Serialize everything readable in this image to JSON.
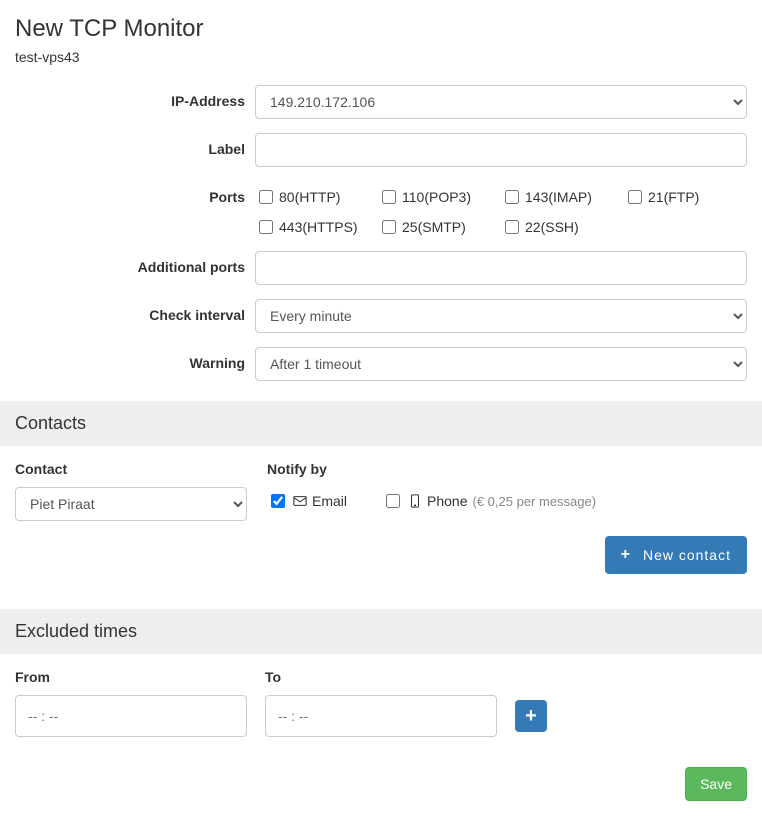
{
  "page": {
    "title": "New TCP Monitor",
    "subtitle": "test-vps43"
  },
  "form": {
    "labels": {
      "ip_address": "IP-Address",
      "label": "Label",
      "ports": "Ports",
      "additional_ports": "Additional ports",
      "check_interval": "Check interval",
      "warning": "Warning"
    },
    "ip_address": {
      "value": "149.210.172.106"
    },
    "label_field": {
      "value": ""
    },
    "ports": [
      {
        "label": "80(HTTP)",
        "checked": false
      },
      {
        "label": "110(POP3)",
        "checked": false
      },
      {
        "label": "143(IMAP)",
        "checked": false
      },
      {
        "label": "21(FTP)",
        "checked": false
      },
      {
        "label": "443(HTTPS)",
        "checked": false
      },
      {
        "label": "25(SMTP)",
        "checked": false
      },
      {
        "label": "22(SSH)",
        "checked": false
      }
    ],
    "additional_ports": {
      "value": ""
    },
    "check_interval": {
      "value": "Every minute"
    },
    "warning": {
      "value": "After 1 timeout"
    }
  },
  "contacts": {
    "section_title": "Contacts",
    "labels": {
      "contact": "Contact",
      "notify_by": "Notify by"
    },
    "contact_select": {
      "value": "Piet Piraat"
    },
    "notify": {
      "email": {
        "label": "Email",
        "checked": true
      },
      "phone": {
        "label": "Phone",
        "note": "(€ 0,25 per message)",
        "checked": false
      }
    },
    "new_contact_btn": "New contact"
  },
  "excluded": {
    "section_title": "Excluded times",
    "labels": {
      "from": "From",
      "to": "To"
    },
    "from": {
      "placeholder": "-- : --"
    },
    "to": {
      "placeholder": "-- : --"
    }
  },
  "buttons": {
    "save": "Save"
  },
  "icons": {
    "plus": "+",
    "chevron_down": "▾"
  }
}
